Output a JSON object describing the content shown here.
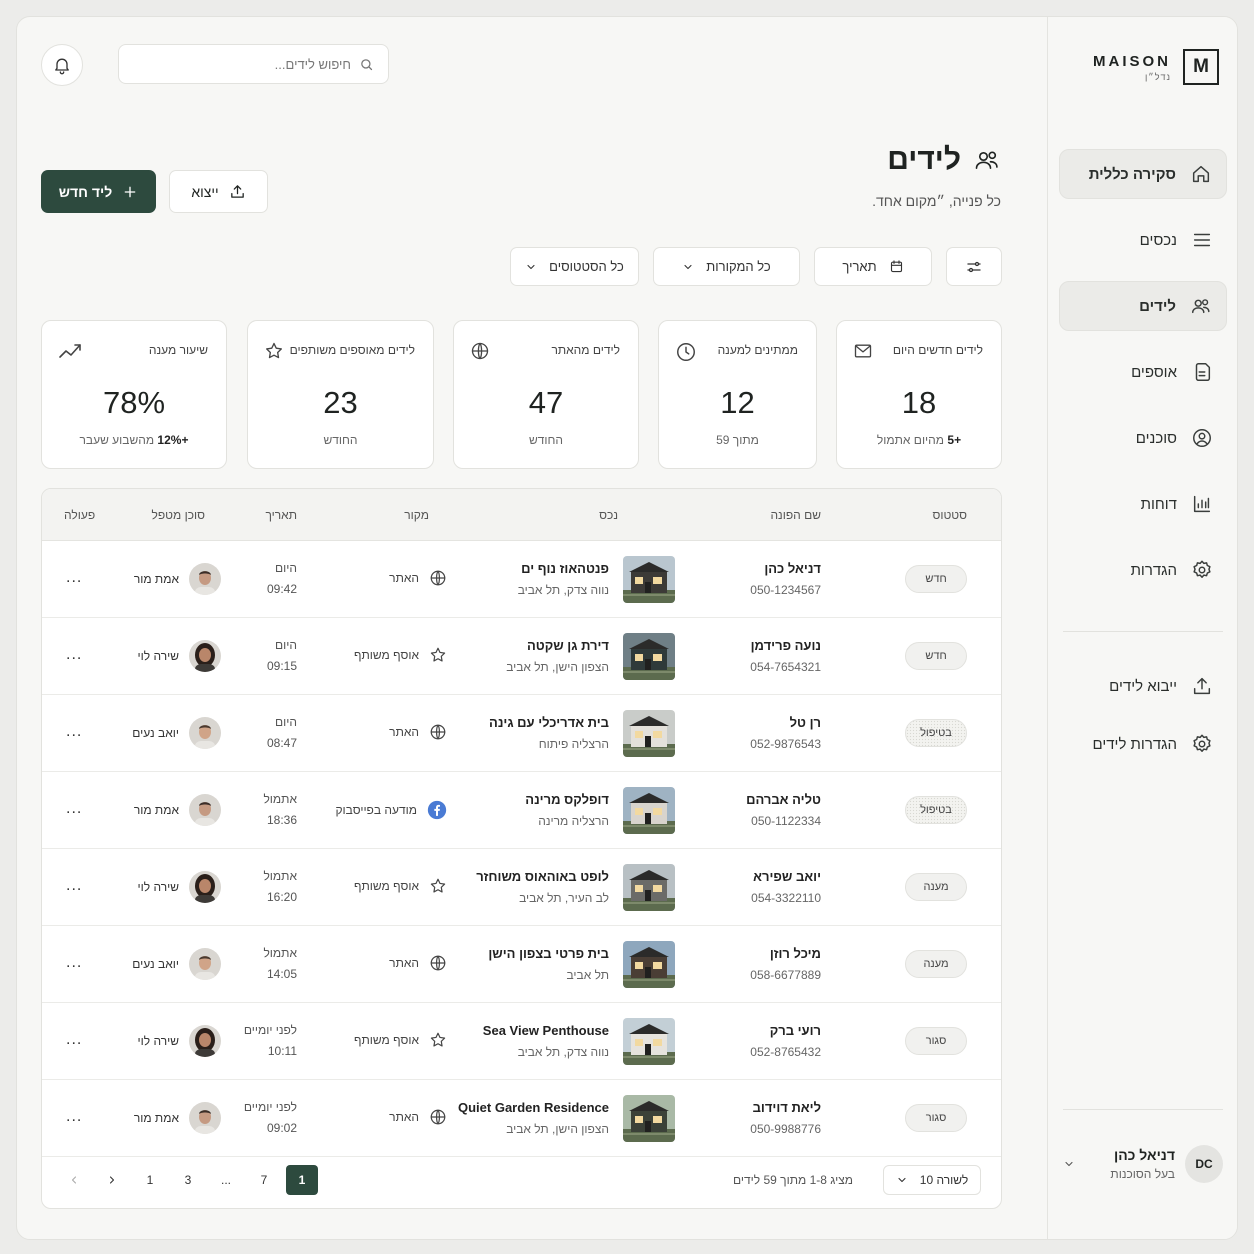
{
  "brand": {
    "name": "MAISON",
    "sub": "נדל״ן",
    "mark": "M"
  },
  "sidebar": {
    "items": [
      {
        "label": "סקירה כללית"
      },
      {
        "label": "נכסים"
      },
      {
        "label": "לידים"
      },
      {
        "label": "אוספים"
      },
      {
        "label": "סוכנים"
      },
      {
        "label": "דוחות"
      },
      {
        "label": "הגדרות"
      }
    ],
    "secondary": [
      {
        "label": "ייבוא לידים"
      },
      {
        "label": "הגדרות לידים"
      }
    ],
    "user": {
      "initials": "DC",
      "name": "דניאל כהן",
      "role": "בעל הסוכנות"
    }
  },
  "header": {
    "search_placeholder": "חיפוש לידים..."
  },
  "page": {
    "title": "לידים",
    "subtitle": "כל פנייה, ״מקום אחד.",
    "new_button": "ליד חדש",
    "export_button": "ייצוא"
  },
  "filters": {
    "date": "תאריך",
    "sources": "כל המקורות",
    "statuses": "כל הסטטוסים"
  },
  "stats": [
    {
      "label": "לידים חדשים היום",
      "value": "18",
      "foot_bold": "+5",
      "foot": "מהיום אתמול"
    },
    {
      "label": "ממתינים למענה",
      "value": "12",
      "foot": "מתוך 59"
    },
    {
      "label": "לידים מהאתר",
      "value": "47",
      "foot": "החודש"
    },
    {
      "label": "לידים מאוספים משותפים",
      "value": "23",
      "foot": "החודש"
    },
    {
      "label": "שיעור מענה",
      "value": "78%",
      "foot_bold": "+12%",
      "foot": "מהשבוע שעבר"
    }
  ],
  "table": {
    "headers": {
      "status": "סטטוס",
      "name": "שם הפונה",
      "property": "נכס",
      "source": "מקור",
      "date": "תאריך",
      "agent": "סוכן מטפל",
      "action": "פעולה"
    },
    "rows": [
      {
        "status": "חדש",
        "name": "דניאל כהן",
        "phone": "050-1234567",
        "property": "פנטהאוז נוף ים",
        "location": "נווה צדק, תל אביב",
        "source": "האתר",
        "date": "היום",
        "time": "09:42",
        "agent": "אמת מור"
      },
      {
        "status": "חדש",
        "name": "נועה פרידמן",
        "phone": "054-7654321",
        "property": "דירת גן שקטה",
        "location": "הצפון הישן, תל אביב",
        "source": "אוסף משותף",
        "date": "היום",
        "time": "09:15",
        "agent": "שירה לוי"
      },
      {
        "status": "בטיפול",
        "name": "רן טל",
        "phone": "052-9876543",
        "property": "בית אדריכלי עם גינה",
        "location": "הרצליה פיתוח",
        "source": "האתר",
        "date": "היום",
        "time": "08:47",
        "agent": "יואב נעים"
      },
      {
        "status": "בטיפול",
        "name": "טליה אברהם",
        "phone": "050-1122334",
        "property": "דופלקס מרינה",
        "location": "הרצליה מרינה",
        "source": "מודעה בפייסבוק",
        "date": "אתמול",
        "time": "18:36",
        "agent": "אמת מור"
      },
      {
        "status": "מענה",
        "name": "יואב שפירא",
        "phone": "054-3322110",
        "property": "לופט באוהאוס משוחזר",
        "location": "לב העיר, תל אביב",
        "source": "אוסף משותף",
        "date": "אתמול",
        "time": "16:20",
        "agent": "שירה לוי"
      },
      {
        "status": "מענה",
        "name": "מיכל רוזן",
        "phone": "058-6677889",
        "property": "בית פרטי בצפון הישן",
        "location": "תל אביב",
        "source": "האתר",
        "date": "אתמול",
        "time": "14:05",
        "agent": "יואב נעים"
      },
      {
        "status": "סגור",
        "name": "רועי ברק",
        "phone": "052-8765432",
        "property": "Sea View Penthouse",
        "location": "נווה צדק, תל אביב",
        "source": "אוסף משותף",
        "date": "לפני יומיים",
        "time": "10:11",
        "agent": "שירה לוי"
      },
      {
        "status": "סגור",
        "name": "ליאת דוידוב",
        "phone": "050-9988776",
        "property": "Quiet Garden Residence",
        "location": "הצפון הישן, תל אביב",
        "source": "האתר",
        "date": "לפני יומיים",
        "time": "09:02",
        "agent": "אמת מור"
      }
    ],
    "action_label": "...",
    "per_page": "10 לשורה",
    "range": "מציג 1-8 מתוך 59 לידים",
    "pages": [
      "1",
      "7",
      "...",
      "3",
      "1"
    ]
  }
}
